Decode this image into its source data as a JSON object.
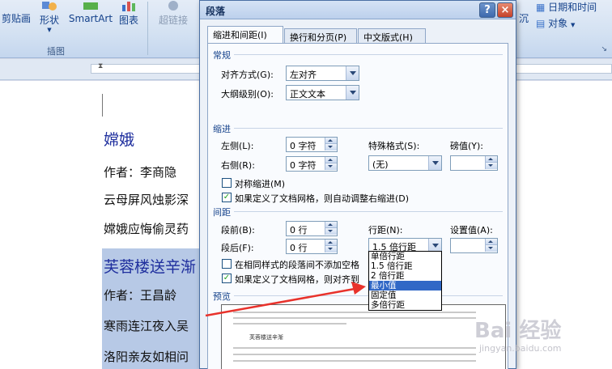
{
  "ribbon": {
    "buttons": [
      "剪贴画",
      "形状",
      "SmartArt",
      "图表",
      "超链接",
      "沉",
      "日期和时间",
      "对象"
    ],
    "group_label": "插图"
  },
  "document": {
    "title1": "嫦娥",
    "line1": "作者：李商隐",
    "line2": "云母屏风烛影深",
    "line3": "嫦娥应悔偷灵药",
    "title2": "芙蓉楼送辛渐",
    "line4": "作者：王昌龄",
    "line5": "寒雨连江夜入吴",
    "line6": "洛阳亲友如相问"
  },
  "dialog": {
    "title": "段落",
    "help": "?",
    "close": "×",
    "tabs": [
      "缩进和间距(I)",
      "换行和分页(P)",
      "中文版式(H)"
    ],
    "general": {
      "heading": "常规",
      "align_label": "对齐方式(G):",
      "align_value": "左对齐",
      "outline_label": "大纲级别(O):",
      "outline_value": "正文文本"
    },
    "indent": {
      "heading": "缩进",
      "left_label": "左侧(L):",
      "left_value": "0 字符",
      "right_label": "右侧(R):",
      "right_value": "0 字符",
      "special_label": "特殊格式(S):",
      "special_value": "(无)",
      "by_label": "磅值(Y):",
      "by_value": "",
      "mirror_label": "对称缩进(M)",
      "auto_label": "如果定义了文档网格，则自动调整右缩进(D)"
    },
    "spacing": {
      "heading": "间距",
      "before_label": "段前(B):",
      "before_value": "0 行",
      "after_label": "段后(F):",
      "after_value": "0 行",
      "line_label": "行距(N):",
      "line_value": "1.5 倍行距",
      "at_label": "设置值(A):",
      "at_value": "",
      "no_space_label": "在相同样式的段落间不添加空格",
      "snap_label": "如果定义了文档网格，则对齐到"
    },
    "line_options": [
      "单倍行距",
      "1.5 倍行距",
      "2 倍行距",
      "最小值",
      "固定值",
      "多倍行距"
    ],
    "preview": {
      "heading": "预览",
      "sample": "芙蓉楼送辛渐"
    }
  },
  "watermark": {
    "text": "Bai 经验",
    "sub": "jingyan.baidu.com"
  }
}
